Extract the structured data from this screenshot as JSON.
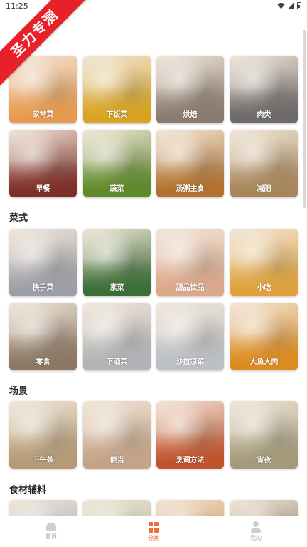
{
  "status_bar": {
    "time": "11:25"
  },
  "ribbon": {
    "text": "圣力专测"
  },
  "sections": [
    {
      "title": "",
      "tiles": [
        {
          "label": "家常菜",
          "color": "#e79a4f"
        },
        {
          "label": "下饭菜",
          "color": "#d8a31f"
        },
        {
          "label": "烘焙",
          "color": "#8a7b70"
        },
        {
          "label": "肉类",
          "color": "#6e6a6a"
        },
        {
          "label": "早餐",
          "color": "#7d2e28"
        },
        {
          "label": "蔬菜",
          "color": "#5e8a2a"
        },
        {
          "label": "汤粥主食",
          "color": "#b2722e"
        },
        {
          "label": "减肥",
          "color": "#a8865a"
        }
      ]
    },
    {
      "title": "菜式",
      "tiles": [
        {
          "label": "快手菜",
          "color": "#9d9fa8"
        },
        {
          "label": "素菜",
          "color": "#3c6e37"
        },
        {
          "label": "甜品饮品",
          "color": "#dca88c"
        },
        {
          "label": "小吃",
          "color": "#e0a23c"
        },
        {
          "label": "零食",
          "color": "#8c7864"
        },
        {
          "label": "下酒菜",
          "color": "#b1b3b6"
        },
        {
          "label": "沙拉凉菜",
          "color": "#bcbfc6"
        },
        {
          "label": "大鱼大肉",
          "color": "#dd8a1e"
        }
      ]
    },
    {
      "title": "场景",
      "tiles": [
        {
          "label": "下午茶",
          "color": "#b59a75"
        },
        {
          "label": "便当",
          "color": "#c4a388"
        },
        {
          "label": "烹调方法",
          "color": "#c0532d"
        },
        {
          "label": "宵夜",
          "color": "#a49a7a"
        }
      ]
    },
    {
      "title": "食材辅料",
      "tiles": [
        {
          "label": "",
          "color": "#9aa4ae"
        },
        {
          "label": "",
          "color": "#a8b08a"
        },
        {
          "label": "",
          "color": "#c8843c"
        },
        {
          "label": "",
          "color": "#7a6a52"
        }
      ]
    }
  ],
  "tabbar": {
    "items": [
      {
        "label": "首页",
        "icon": "home-icon"
      },
      {
        "label": "分类",
        "icon": "grid-icon"
      },
      {
        "label": "我的",
        "icon": "user-icon"
      }
    ],
    "active_index": 1,
    "active_color": "#ef6a3a"
  }
}
